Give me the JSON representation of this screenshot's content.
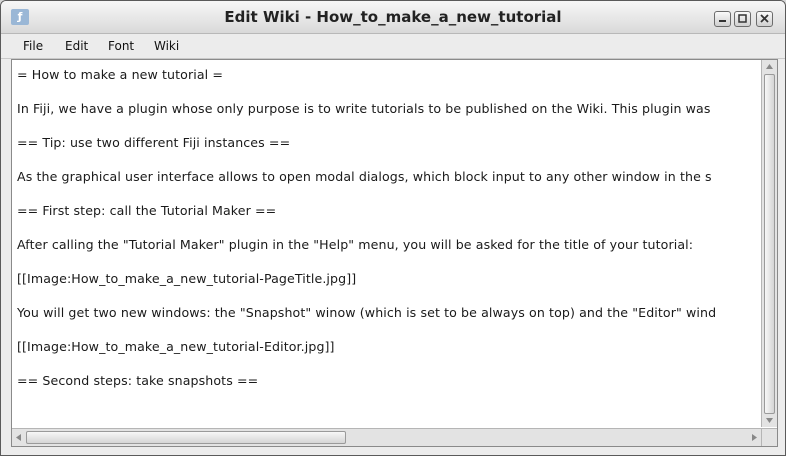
{
  "window": {
    "title": "Edit Wiki - How_to_make_a_new_tutorial",
    "app_icon": "fiji-icon",
    "controls": [
      "minimize-icon",
      "maximize-icon",
      "close-icon"
    ]
  },
  "menubar": {
    "items": [
      "File",
      "Edit",
      "Font",
      "Wiki"
    ]
  },
  "editor": {
    "lines": [
      "= How to make a new tutorial =",
      "In Fiji, we have a plugin whose only purpose is to write tutorials to be published on the Wiki.  This plugin was",
      "== Tip: use two different Fiji instances ==",
      "As the graphical user interface allows to open modal dialogs, which block input to any other window in the s",
      "== First step: call the Tutorial Maker ==",
      "After calling the \"Tutorial Maker\" plugin in the \"Help\" menu, you will be asked for the title of your tutorial:",
      "[[Image:How_to_make_a_new_tutorial-PageTitle.jpg]]",
      "You will get two new windows: the \"Snapshot\" winow (which is set to be always on top) and the \"Editor\" wind",
      "[[Image:How_to_make_a_new_tutorial-Editor.jpg]]",
      "== Second steps: take snapshots =="
    ]
  },
  "colors": {
    "title_bg": "#e3e3e3",
    "editor_bg": "#ffffff",
    "text": "#1a1a1a"
  }
}
